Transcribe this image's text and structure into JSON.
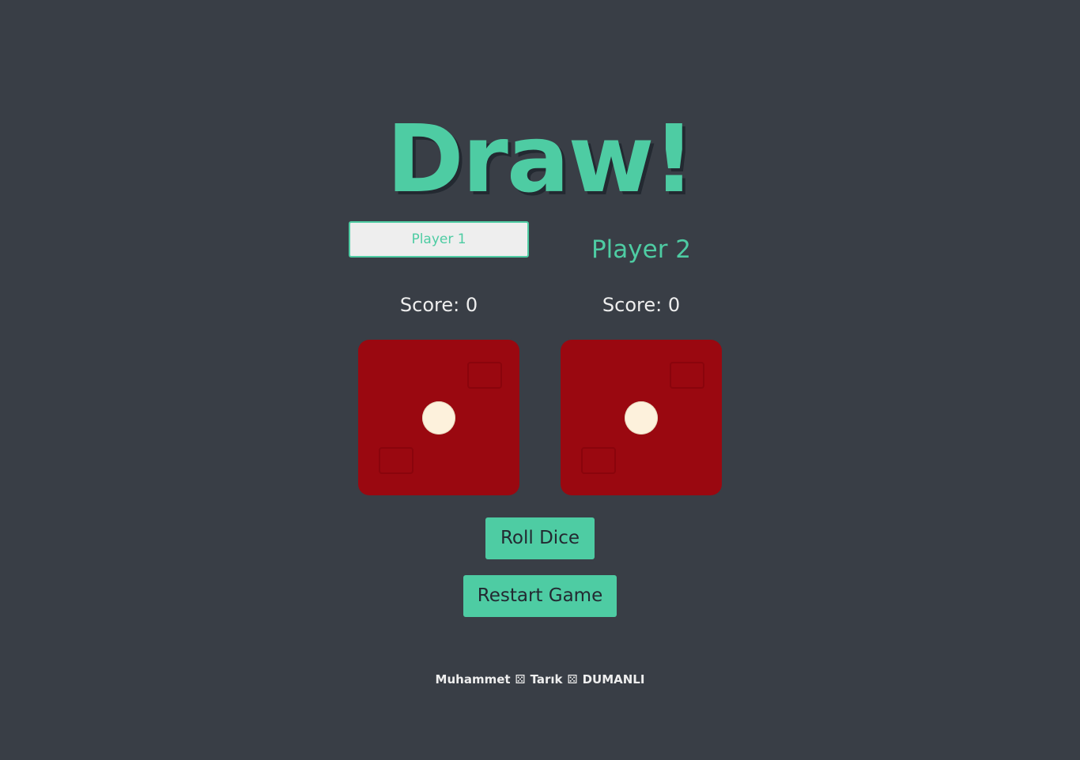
{
  "title": "Draw!",
  "players": {
    "player1": {
      "input_placeholder": "Player 1",
      "score_text": "Score: 0"
    },
    "player2": {
      "name": "Player 2",
      "score_text": "Score: 0"
    }
  },
  "dice": {
    "die1_value": 1,
    "die2_value": 1,
    "die_color": "#9a0810",
    "pip_color": "#fdf1dc"
  },
  "buttons": {
    "roll_label": "Roll Dice",
    "restart_label": "Restart Game"
  },
  "footer": {
    "part1": "Muhammet",
    "part2": "Tarık",
    "part3": "DUMANLI",
    "separator_icon": "die-icon",
    "separator_glyph": "⚄"
  },
  "colors": {
    "background": "#393e46",
    "accent": "#4ecca3",
    "text_light": "#eeeeee",
    "button_text": "#232931"
  }
}
